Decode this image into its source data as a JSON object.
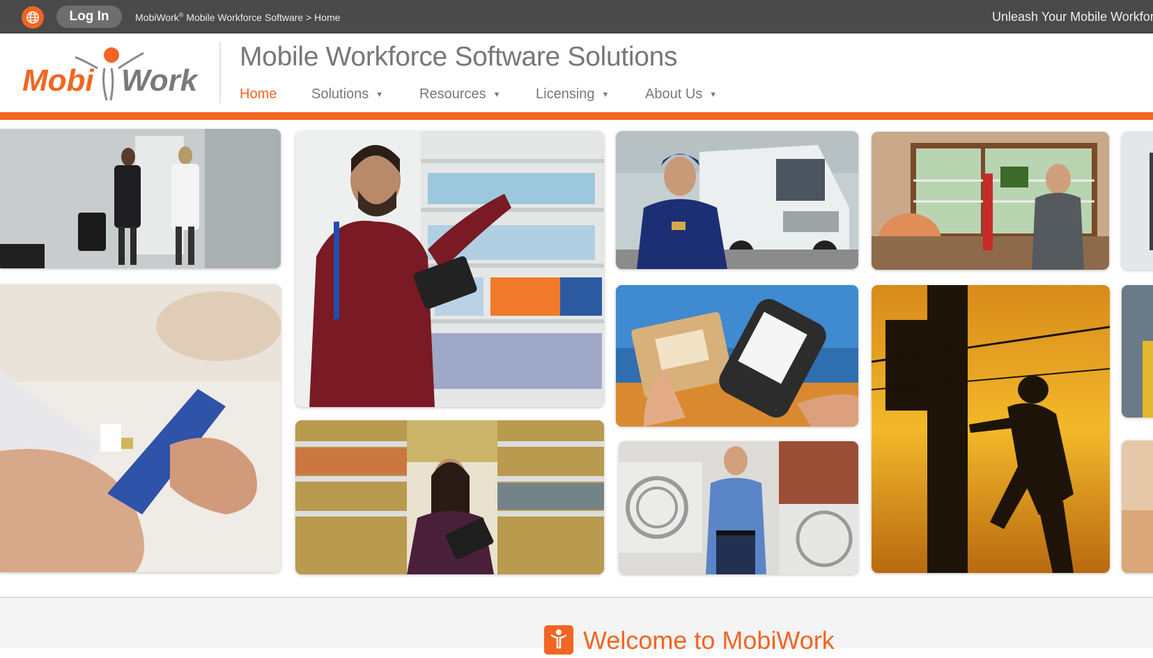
{
  "topbar": {
    "login_label": "Log In",
    "breadcrumb_brand": "MobiWork",
    "breadcrumb_reg": "®",
    "breadcrumb_rest": " Mobile Workforce Software > Home",
    "tagline": "Unleash Your Mobile Workforce"
  },
  "header": {
    "logo_text_left": "Mobi",
    "logo_text_right": "Work",
    "site_title": "Mobile Workforce Software Solutions"
  },
  "nav": {
    "items": [
      {
        "label": "Home",
        "has_dropdown": false,
        "active": true
      },
      {
        "label": "Solutions",
        "has_dropdown": true,
        "active": false
      },
      {
        "label": "Resources",
        "has_dropdown": true,
        "active": false
      },
      {
        "label": "Licensing",
        "has_dropdown": true,
        "active": false
      },
      {
        "label": "About Us",
        "has_dropdown": true,
        "active": false
      }
    ],
    "caret": "▼"
  },
  "gallery": {
    "tiles": [
      {
        "subject": "business-handshake-photo"
      },
      {
        "subject": "card-payment-photo"
      },
      {
        "subject": "retail-shelf-tablet-photo"
      },
      {
        "subject": "grocery-aisle-tablet-photo"
      },
      {
        "subject": "delivery-van-driver-photo"
      },
      {
        "subject": "package-scanner-photo"
      },
      {
        "subject": "hvac-technician-photo"
      },
      {
        "subject": "home-repair-drill-photo"
      },
      {
        "subject": "utility-pole-worker-photo"
      }
    ]
  },
  "welcome": {
    "title": "Welcome to MobiWork"
  },
  "colors": {
    "brand_orange": "#f26522",
    "topbar_bg": "#4a4a4a",
    "nav_gray": "#777777"
  }
}
